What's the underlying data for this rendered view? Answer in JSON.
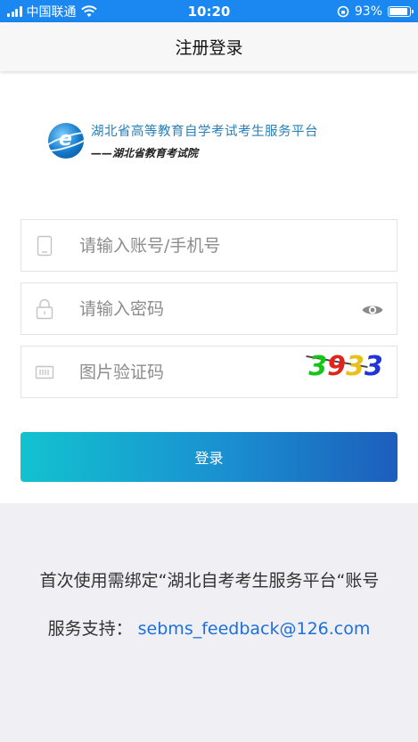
{
  "status_bar": {
    "carrier": "中国联通",
    "time": "10:20",
    "battery_text": "93%",
    "battery_level": 0.93
  },
  "nav": {
    "title": "注册登录"
  },
  "logo": {
    "title": "湖北省高等教育自学考试考生服务平台",
    "subtitle": "——湖北省教育考试院"
  },
  "form": {
    "account_placeholder": "请输入账号/手机号",
    "password_placeholder": "请输入密码",
    "captcha_placeholder": "图片验证码",
    "captcha_chars": [
      {
        "char": "3",
        "color": "#18c418"
      },
      {
        "char": "9",
        "color": "#e0241c"
      },
      {
        "char": "3",
        "color": "#e8c018"
      },
      {
        "char": "3",
        "color": "#2035d8"
      }
    ]
  },
  "login_button": {
    "label": "登录"
  },
  "footer": {
    "notice": "首次使用需绑定“湖北自考考生服务平台“账号",
    "support_label": "服务支持：",
    "support_email": "sebms_feedback@126.com"
  },
  "colors": {
    "status_bar": "#1a88f0",
    "accent_gradient_start": "#13c2cf",
    "accent_gradient_end": "#1d5ebc",
    "link": "#1e6fd9",
    "footer_bg": "#efeff4"
  }
}
